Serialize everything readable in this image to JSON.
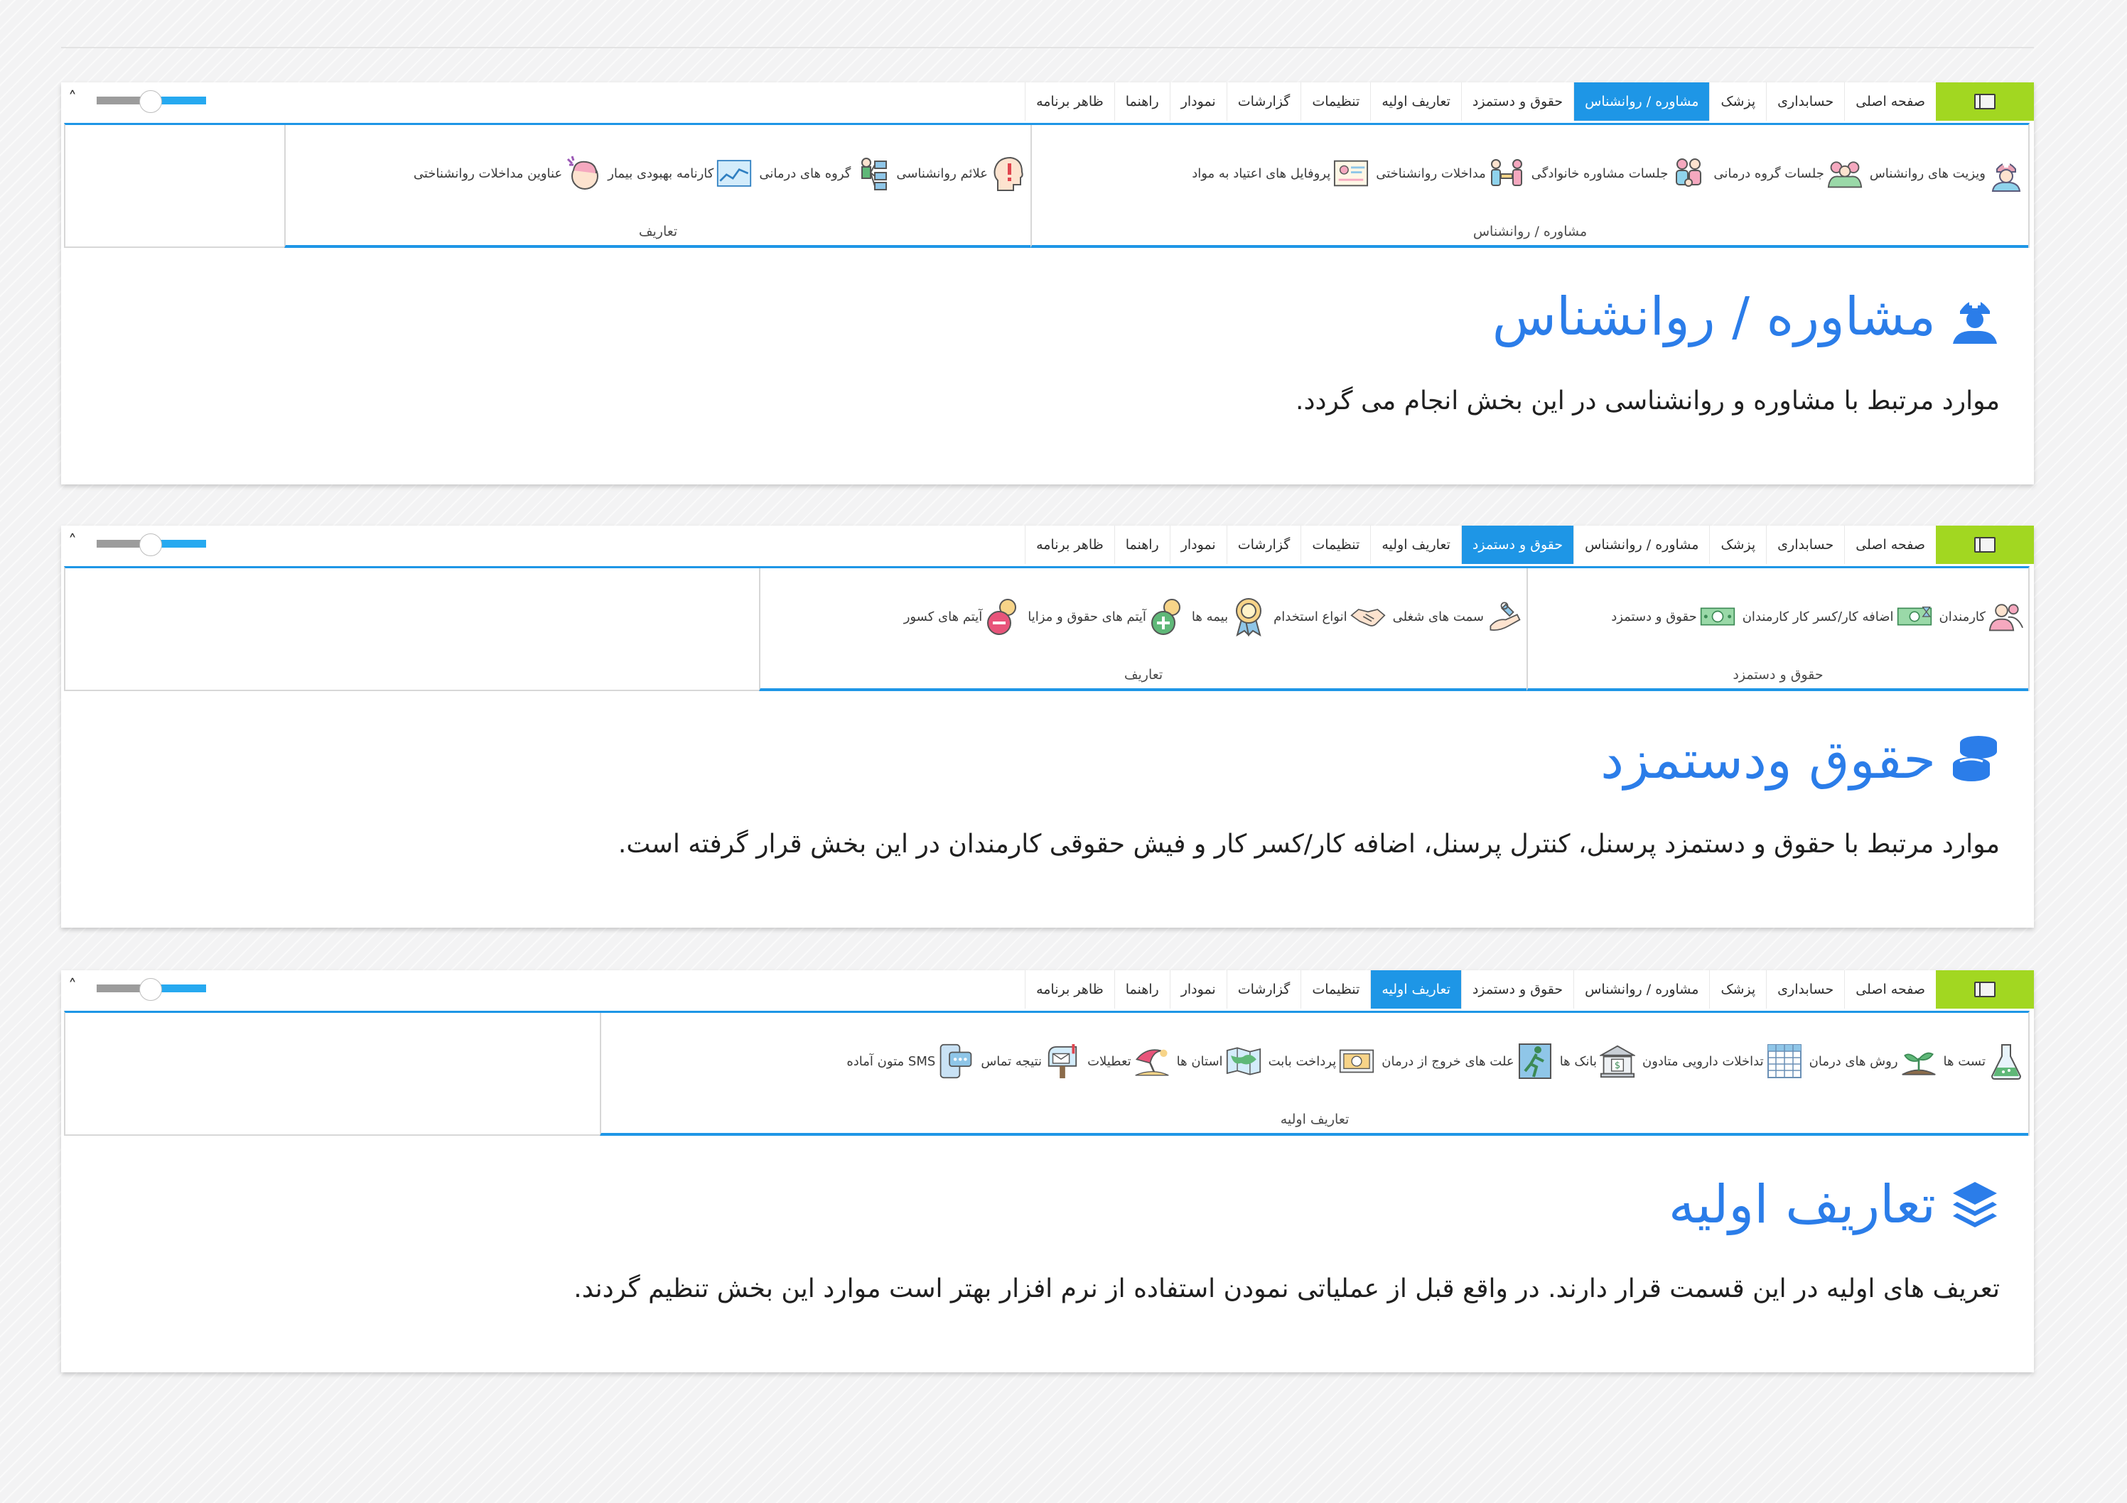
{
  "colors": {
    "accent": "#1e96e6",
    "tab_icon_bg": "#a2d721",
    "heading": "#2b7de9"
  },
  "tabs": [
    "صفحه اصلی",
    "حسابداری",
    "پزشک",
    "مشاوره / روانشناس",
    "حقوق و دستمزد",
    "تعاریف اولیه",
    "تنظیمات",
    "گزارشات",
    "نمودار",
    "راهنما",
    "ظاهر برنامه"
  ],
  "controls": {
    "collapse": "˄"
  },
  "sections": [
    {
      "active_tab_index": 3,
      "groups": [
        {
          "label": "مشاوره / روانشناس",
          "items": [
            {
              "label": "ویزیت های روانشناس",
              "icon": "nurse-icon"
            },
            {
              "label": "جلسات گروه درمانی",
              "icon": "group-people-icon"
            },
            {
              "label": "جلسات مشاوره خانوادگی",
              "icon": "family-icon"
            },
            {
              "label": "مداخلات روانشناختی",
              "icon": "meeting-icon"
            },
            {
              "label": "پروفایل های اعتیاد به مواد",
              "icon": "profile-card-icon"
            }
          ]
        },
        {
          "label": "تعاریف",
          "items": [
            {
              "label": "علائم روانشناسی",
              "icon": "head-exclamation-icon"
            },
            {
              "label": "گروه های درمانی",
              "icon": "org-chart-icon"
            },
            {
              "label": "کارنامه بهبودی بیمار",
              "icon": "line-chart-icon"
            },
            {
              "label": "عناوین مداخلات روانشناختی",
              "icon": "head-thinking-icon"
            }
          ]
        }
      ],
      "heading": "مشاوره / روانشناس",
      "heading_icon": "nurse-icon",
      "description": "موارد مرتبط با مشاوره و روانشناسی در این بخش انجام می گردد."
    },
    {
      "active_tab_index": 4,
      "groups": [
        {
          "label": "حقوق و دستمزد",
          "items": [
            {
              "label": "کارمندان",
              "icon": "employees-icon"
            },
            {
              "label": "اضافه کار/کسر کار کارمندان",
              "icon": "money-hourglass-icon"
            },
            {
              "label": "حقوق و دستمزد",
              "icon": "banknote-icon"
            }
          ]
        },
        {
          "label": "تعاریف",
          "items": [
            {
              "label": "سمت های شغلی",
              "icon": "wrench-hand-icon"
            },
            {
              "label": "انواع استخدام",
              "icon": "handshake-icon"
            },
            {
              "label": "بیمه ها",
              "icon": "badge-icon"
            },
            {
              "label": "آیتم های حقوق و مزایا",
              "icon": "plus-coin-icon"
            },
            {
              "label": "آیتم های کسور",
              "icon": "minus-coin-icon"
            }
          ]
        }
      ],
      "heading": "حقوق ودستمزد",
      "heading_icon": "coins-stack-icon",
      "description": "موارد مرتبط با حقوق و دستمزد پرسنل، کنترل پرسنل، اضافه کار/کسر کار و فیش حقوقی کارمندان در این بخش قرار گرفته است."
    },
    {
      "active_tab_index": 5,
      "groups": [
        {
          "label": "تعاریف اولیه",
          "items": [
            {
              "label": "تست ها",
              "icon": "flask-icon"
            },
            {
              "label": "روش های درمان",
              "icon": "sprout-icon"
            },
            {
              "label": "تداخلات دارویی متادون",
              "icon": "grid-icon"
            },
            {
              "label": "بانک ها",
              "icon": "bank-icon"
            },
            {
              "label": "علت های خروج از درمان",
              "icon": "exit-icon"
            },
            {
              "label": "پرداخت بابت",
              "icon": "payment-icon"
            },
            {
              "label": "استان ها",
              "icon": "map-icon"
            },
            {
              "label": "تعطیلات",
              "icon": "umbrella-icon"
            },
            {
              "label": "نتیجه تماس",
              "icon": "mailbox-icon"
            },
            {
              "label": "متون آماده SMS",
              "icon": "phone-sms-icon"
            }
          ]
        }
      ],
      "heading": "تعاریف اولیه",
      "heading_icon": "layers-icon",
      "description": "تعریف های اولیه در این قسمت قرار دارند. در واقع قبل از عملیاتی نمودن استفاده از نرم افزار بهتر است موارد این بخش تنظیم گردند."
    }
  ]
}
